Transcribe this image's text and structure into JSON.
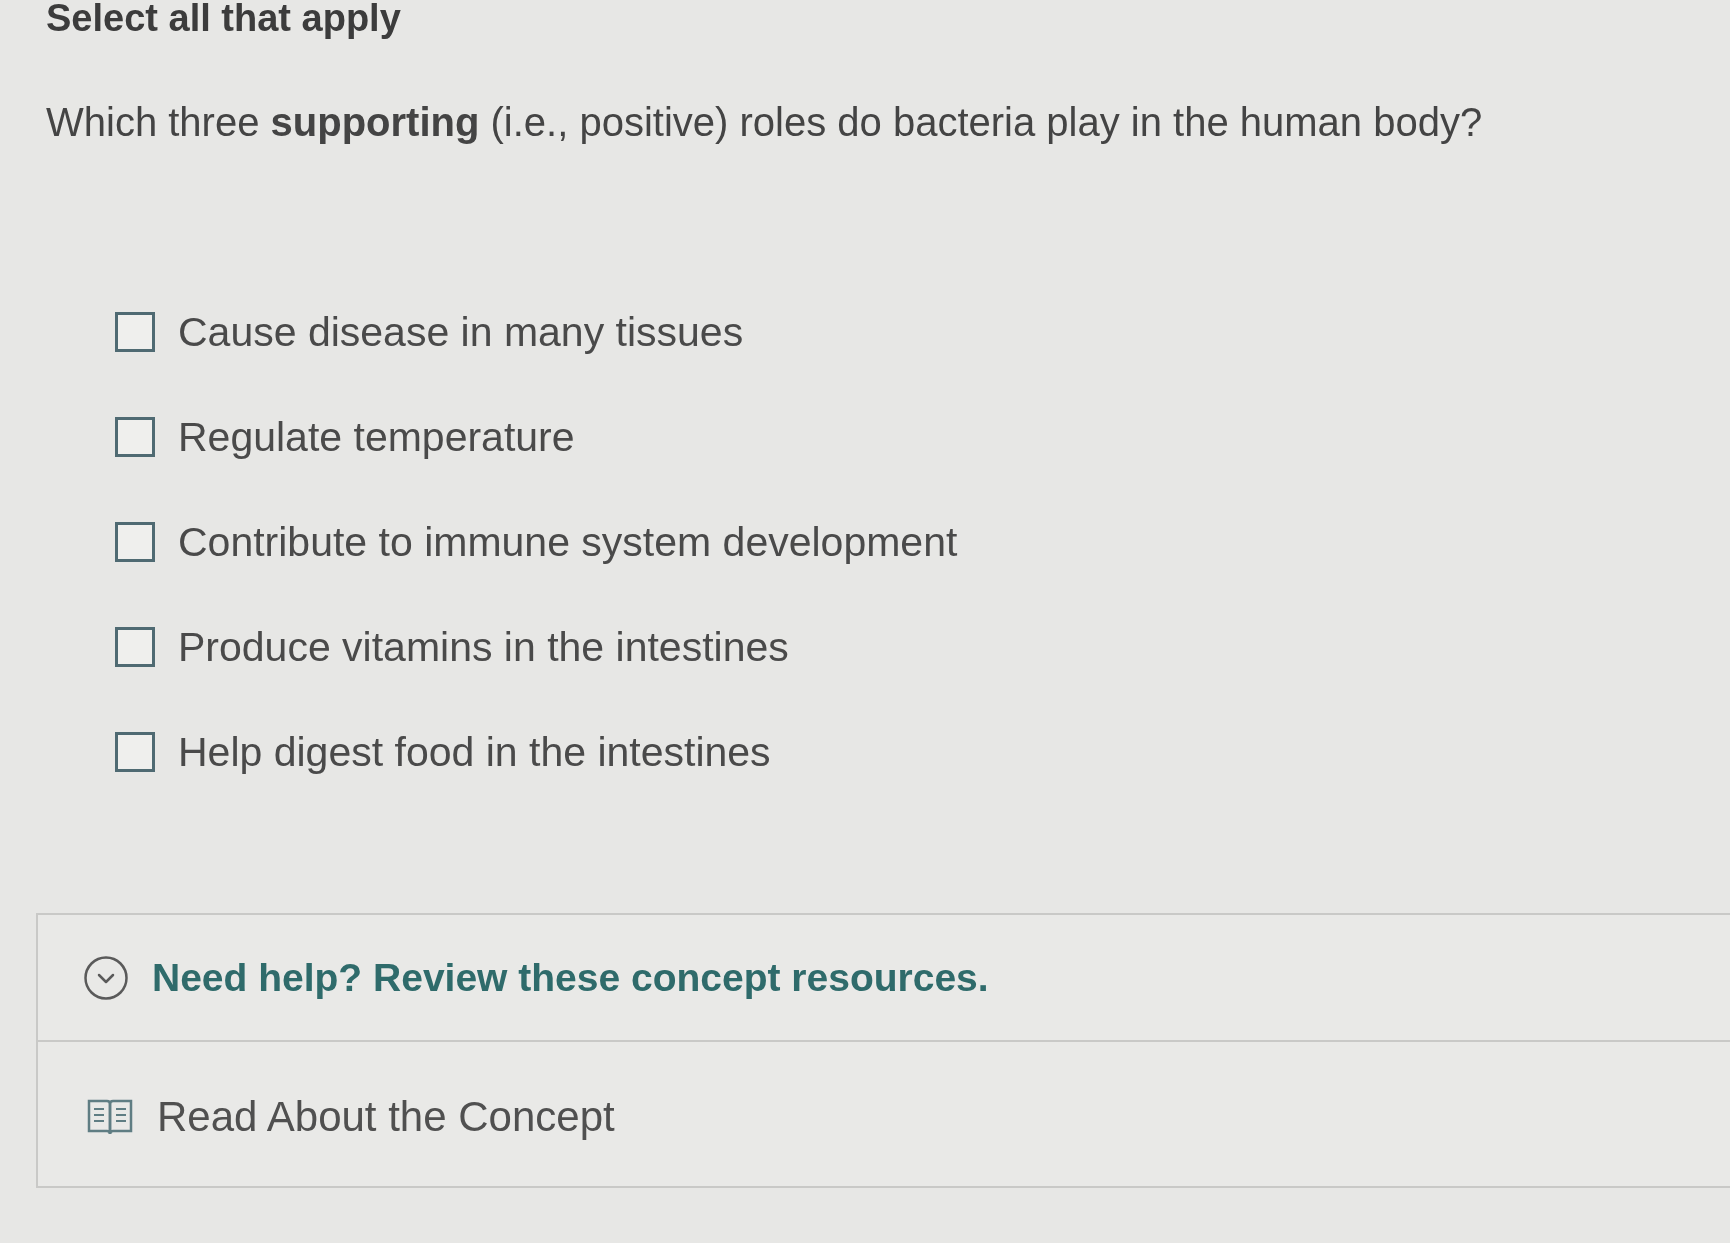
{
  "instruction": "Select all that apply",
  "question": "Which three **supporting** (i.e., positive) roles do bacteria play in the human body?",
  "options": [
    {
      "label": "Cause disease in many tissues",
      "checked": false
    },
    {
      "label": "Regulate temperature",
      "checked": false
    },
    {
      "label": "Contribute to immune system development",
      "checked": false
    },
    {
      "label": "Produce vitamins in the intestines",
      "checked": false
    },
    {
      "label": "Help digest food in the intestines",
      "checked": false
    }
  ],
  "help": {
    "title": "Need help? Review these concept resources.",
    "expanded": true,
    "resources": [
      {
        "label": "Read About the Concept"
      }
    ]
  }
}
